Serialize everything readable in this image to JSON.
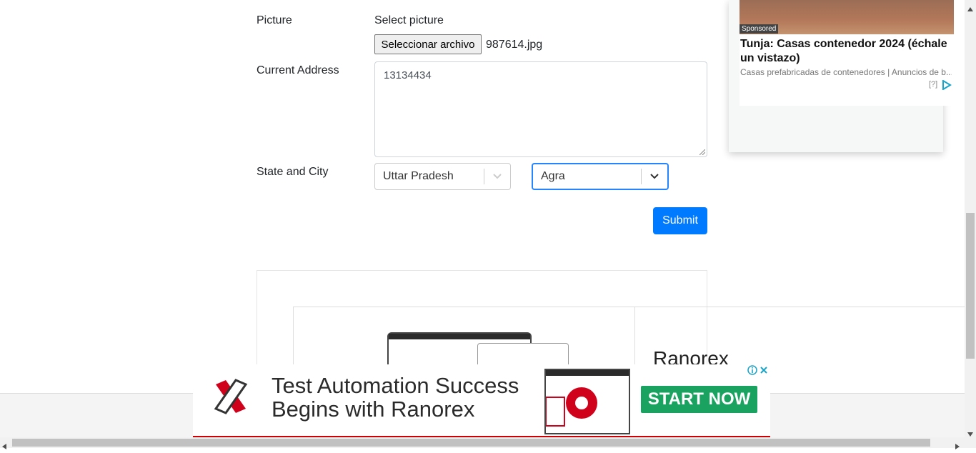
{
  "form": {
    "picture_label": "Picture",
    "select_picture": "Select picture",
    "file_button": "Seleccionar archivo",
    "file_name": "987614.jpg",
    "address_label": "Current Address",
    "address_value": "13134434",
    "state_city_label": "State and City",
    "state_value": "Uttar Pradesh",
    "city_value": "Agra",
    "submit_label": "Submit"
  },
  "side_ad": {
    "sponsored": "Sponsored",
    "title": "Tunja: Casas contenedor 2024 (échale un vistazo)",
    "source": "Casas prefabricadas de contenedores | Anuncios de b...",
    "help": "[?]"
  },
  "inline_ad": {
    "brand": "Ranorex"
  },
  "banner_ad": {
    "line1": "Test Automation Success",
    "line2": "Begins with Ranorex",
    "cta": "START NOW"
  },
  "colors": {
    "primary": "#007bff",
    "cta_green": "#1aa260",
    "brand_red": "#d0021b"
  }
}
